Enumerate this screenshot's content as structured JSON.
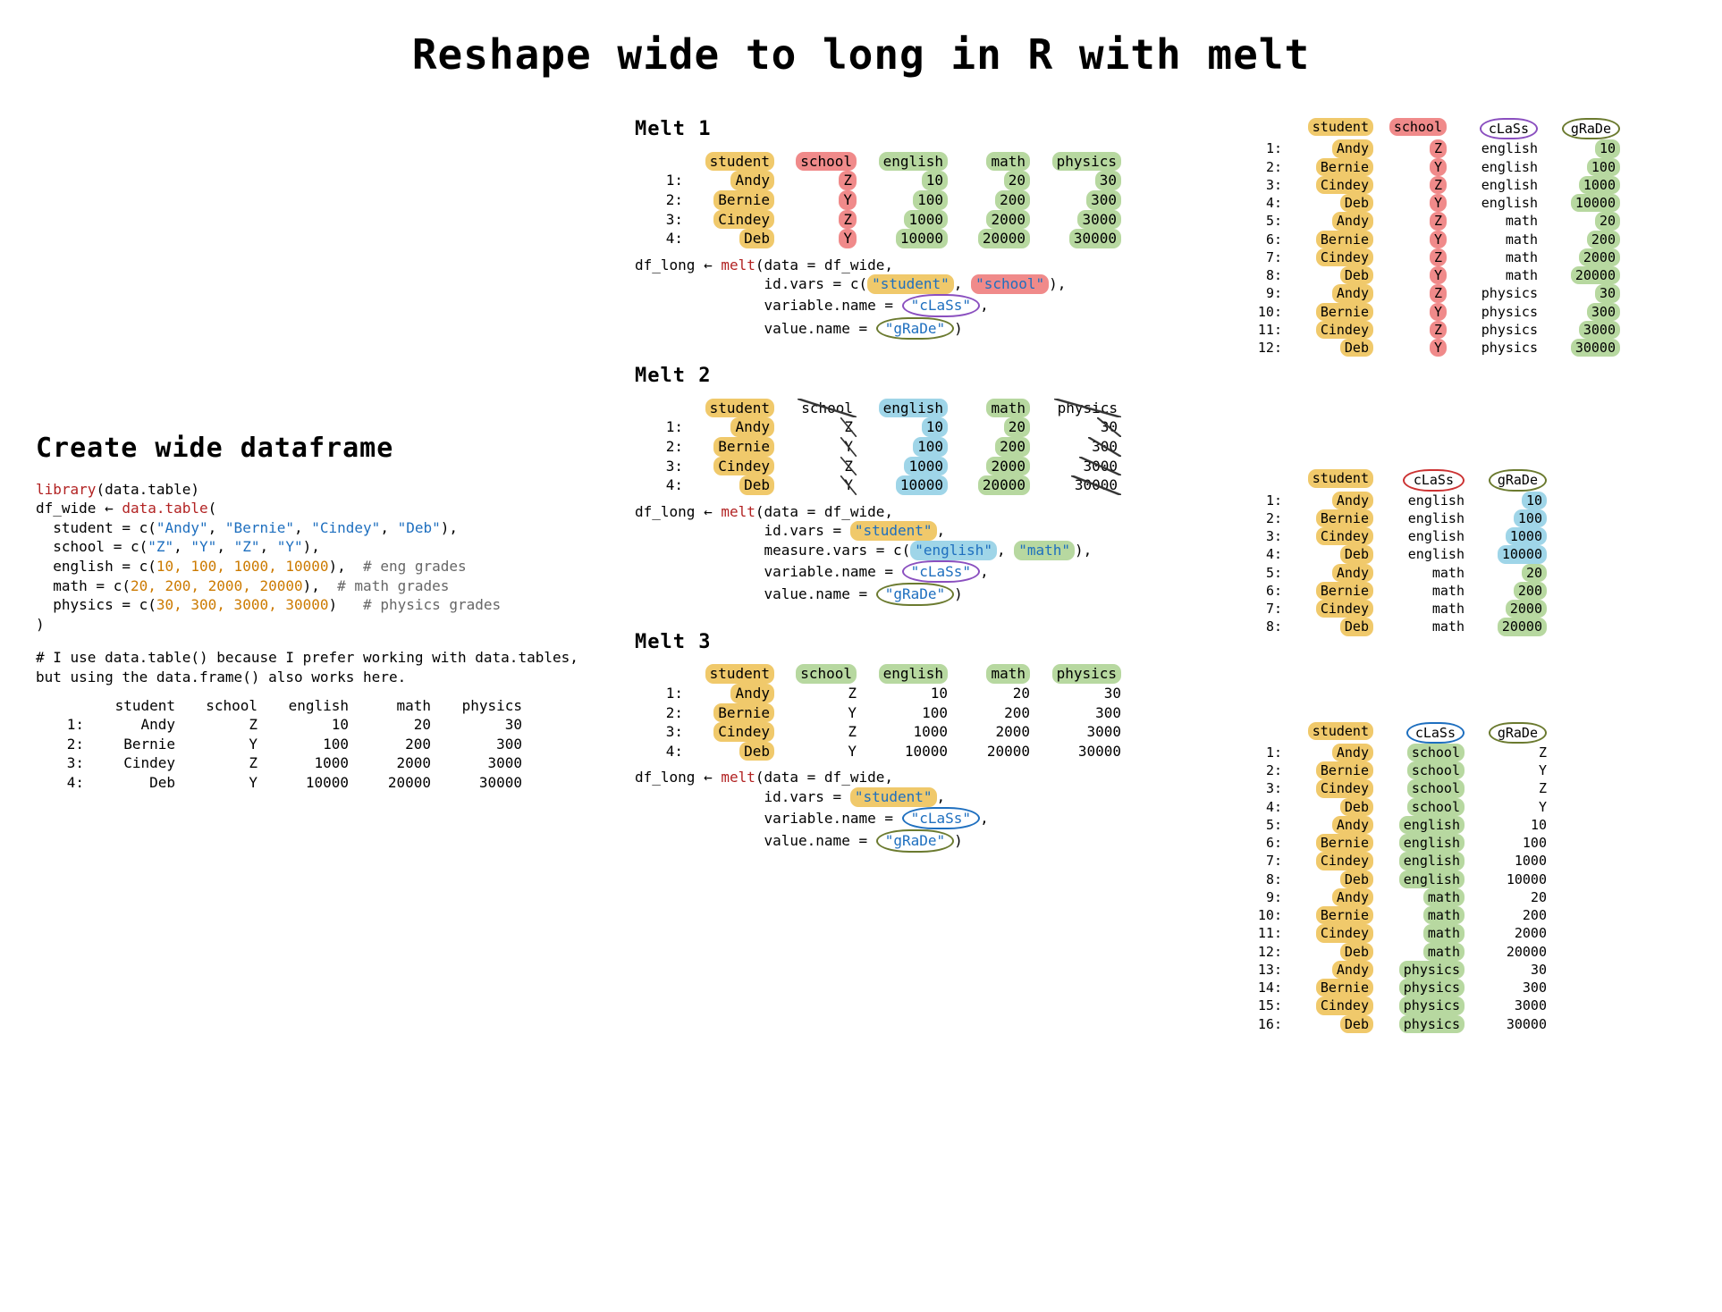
{
  "title": "Reshape wide to long in R with melt",
  "left": {
    "heading": "Create wide dataframe",
    "code": {
      "l1_a": "library",
      "l1_b": "(data.table)",
      "l2_a": "df_wide ← ",
      "l2_b": "data.table",
      "l2_c": "(",
      "l3_a": "  student = c(",
      "l3_s1": "\"Andy\"",
      "l3_c1": ", ",
      "l3_s2": "\"Bernie\"",
      "l3_c2": ", ",
      "l3_s3": "\"Cindey\"",
      "l3_c3": ", ",
      "l3_s4": "\"Deb\"",
      "l3_end": "),",
      "l4_a": "  school = c(",
      "l4_s1": "\"Z\"",
      "l4_c1": ", ",
      "l4_s2": "\"Y\"",
      "l4_c2": ", ",
      "l4_s3": "\"Z\"",
      "l4_c3": ", ",
      "l4_s4": "\"Y\"",
      "l4_end": "),",
      "l5_a": "  english = c(",
      "l5_n": "10, 100, 1000, 10000",
      "l5_end": "),  ",
      "l5_cmt": "# eng grades",
      "l6_a": "  math = c(",
      "l6_n": "20, 200, 2000, 20000",
      "l6_end": "),  ",
      "l6_cmt": "# math grades",
      "l7_a": "  physics = c(",
      "l7_n": "30, 300, 3000, 30000",
      "l7_end": ")   ",
      "l7_cmt": "# physics grades",
      "l8": ")"
    },
    "note_pre": "# I use ",
    "note_dt": "data.table()",
    "note_mid": " because I prefer working with data.tables, but using the ",
    "note_df": "data.frame()",
    "note_post": " also works here.",
    "wide_headers": [
      "student",
      "school",
      "english",
      "math",
      "physics"
    ],
    "wide_rows": [
      {
        "i": "1:",
        "cells": [
          "Andy",
          "Z",
          "10",
          "20",
          "30"
        ]
      },
      {
        "i": "2:",
        "cells": [
          "Bernie",
          "Y",
          "100",
          "200",
          "300"
        ]
      },
      {
        "i": "3:",
        "cells": [
          "Cindey",
          "Z",
          "1000",
          "2000",
          "3000"
        ]
      },
      {
        "i": "4:",
        "cells": [
          "Deb",
          "Y",
          "10000",
          "20000",
          "30000"
        ]
      }
    ]
  },
  "mid": {
    "melt1": {
      "title": "Melt 1",
      "headers": [
        "student",
        "school",
        "english",
        "math",
        "physics"
      ],
      "header_style": [
        "hl-y",
        "hl-r",
        "hl-g",
        "hl-g",
        "hl-g"
      ],
      "rows": [
        {
          "i": "1:",
          "cells": [
            "Andy",
            "Z",
            "10",
            "20",
            "30"
          ],
          "style": [
            "hl-y",
            "hl-r",
            "hl-g",
            "hl-g",
            "hl-g"
          ]
        },
        {
          "i": "2:",
          "cells": [
            "Bernie",
            "Y",
            "100",
            "200",
            "300"
          ],
          "style": [
            "hl-y",
            "hl-r",
            "hl-g",
            "hl-g",
            "hl-g"
          ]
        },
        {
          "i": "3:",
          "cells": [
            "Cindey",
            "Z",
            "1000",
            "2000",
            "3000"
          ],
          "style": [
            "hl-y",
            "hl-r",
            "hl-g",
            "hl-g",
            "hl-g"
          ]
        },
        {
          "i": "4:",
          "cells": [
            "Deb",
            "Y",
            "10000",
            "20000",
            "30000"
          ],
          "style": [
            "hl-y",
            "hl-r",
            "hl-g",
            "hl-g",
            "hl-g"
          ]
        }
      ],
      "code": {
        "l1_a": "df_long ← ",
        "l1_b": "melt",
        "l1_c": "(data = df_wide,",
        "l2_a": "               id.vars = c(",
        "l2_s1": "\"student\"",
        "l2_c": ", ",
        "l2_s2": "\"school\"",
        "l2_end": "),",
        "l3_a": "               variable.name = ",
        "l3_s": "\"cLaSs\"",
        "l3_end": ",",
        "l4_a": "               value.name = ",
        "l4_s": "\"gRaDe\"",
        "l4_end": ")"
      }
    },
    "melt2": {
      "title": "Melt 2",
      "headers": [
        "student",
        "school",
        "english",
        "math",
        "physics"
      ],
      "header_style": [
        "hl-y",
        "strike",
        "hl-b",
        "hl-g",
        "strike"
      ],
      "rows": [
        {
          "i": "1:",
          "cells": [
            "Andy",
            "Z",
            "10",
            "20",
            "30"
          ],
          "style": [
            "hl-y",
            "strike",
            "hl-b",
            "hl-g",
            "strike"
          ]
        },
        {
          "i": "2:",
          "cells": [
            "Bernie",
            "Y",
            "100",
            "200",
            "300"
          ],
          "style": [
            "hl-y",
            "strike",
            "hl-b",
            "hl-g",
            "strike"
          ]
        },
        {
          "i": "3:",
          "cells": [
            "Cindey",
            "Z",
            "1000",
            "2000",
            "3000"
          ],
          "style": [
            "hl-y",
            "strike",
            "hl-b",
            "hl-g",
            "strike"
          ]
        },
        {
          "i": "4:",
          "cells": [
            "Deb",
            "Y",
            "10000",
            "20000",
            "30000"
          ],
          "style": [
            "hl-y",
            "strike",
            "hl-b",
            "hl-g",
            "strike"
          ]
        }
      ],
      "code": {
        "l1_a": "df_long ← ",
        "l1_b": "melt",
        "l1_c": "(data = df_wide,",
        "l2_a": "               id.vars = ",
        "l2_s": "\"student\"",
        "l2_end": ",",
        "l3_a": "               measure.vars = c(",
        "l3_s1": "\"english\"",
        "l3_c": ", ",
        "l3_s2": "\"math\"",
        "l3_end": "),",
        "l4_a": "               variable.name = ",
        "l4_s": "\"cLaSs\"",
        "l4_end": ",",
        "l5_a": "               value.name = ",
        "l5_s": "\"gRaDe\"",
        "l5_end": ")"
      }
    },
    "melt3": {
      "title": "Melt 3",
      "headers": [
        "student",
        "school",
        "english",
        "math",
        "physics"
      ],
      "header_style": [
        "hl-y",
        "hl-g",
        "hl-g",
        "hl-g",
        "hl-g"
      ],
      "rows": [
        {
          "i": "1:",
          "cells": [
            "Andy",
            "Z",
            "10",
            "20",
            "30"
          ],
          "style": [
            "hl-y",
            "",
            "",
            "",
            ""
          ]
        },
        {
          "i": "2:",
          "cells": [
            "Bernie",
            "Y",
            "100",
            "200",
            "300"
          ],
          "style": [
            "hl-y",
            "",
            "",
            "",
            ""
          ]
        },
        {
          "i": "3:",
          "cells": [
            "Cindey",
            "Z",
            "1000",
            "2000",
            "3000"
          ],
          "style": [
            "hl-y",
            "",
            "",
            "",
            ""
          ]
        },
        {
          "i": "4:",
          "cells": [
            "Deb",
            "Y",
            "10000",
            "20000",
            "30000"
          ],
          "style": [
            "hl-y",
            "",
            "",
            "",
            ""
          ]
        }
      ],
      "code": {
        "l1_a": "df_long ← ",
        "l1_b": "melt",
        "l1_c": "(data = df_wide,",
        "l2_a": "               id.vars = ",
        "l2_s": "\"student\"",
        "l2_end": ",",
        "l3_a": "               variable.name = ",
        "l3_s": "\"cLaSs\"",
        "l3_end": ",",
        "l4_a": "               value.name = ",
        "l4_s": "\"gRaDe\"",
        "l4_end": ")"
      }
    }
  },
  "right": {
    "out1": {
      "headers": [
        "student",
        "school",
        "cLaSs",
        "gRaDe"
      ],
      "header_style": [
        "hl-y",
        "hl-r",
        "circ-purple",
        "circ-olive"
      ],
      "rows": [
        {
          "i": "1:",
          "cells": [
            "Andy",
            "Z",
            "english",
            "10"
          ],
          "style": [
            "hl-y",
            "hl-r",
            "",
            "hl-g"
          ]
        },
        {
          "i": "2:",
          "cells": [
            "Bernie",
            "Y",
            "english",
            "100"
          ],
          "style": [
            "hl-y",
            "hl-r",
            "",
            "hl-g"
          ]
        },
        {
          "i": "3:",
          "cells": [
            "Cindey",
            "Z",
            "english",
            "1000"
          ],
          "style": [
            "hl-y",
            "hl-r",
            "",
            "hl-g"
          ]
        },
        {
          "i": "4:",
          "cells": [
            "Deb",
            "Y",
            "english",
            "10000"
          ],
          "style": [
            "hl-y",
            "hl-r",
            "",
            "hl-g"
          ]
        },
        {
          "i": "5:",
          "cells": [
            "Andy",
            "Z",
            "math",
            "20"
          ],
          "style": [
            "hl-y",
            "hl-r",
            "",
            "hl-g"
          ]
        },
        {
          "i": "6:",
          "cells": [
            "Bernie",
            "Y",
            "math",
            "200"
          ],
          "style": [
            "hl-y",
            "hl-r",
            "",
            "hl-g"
          ]
        },
        {
          "i": "7:",
          "cells": [
            "Cindey",
            "Z",
            "math",
            "2000"
          ],
          "style": [
            "hl-y",
            "hl-r",
            "",
            "hl-g"
          ]
        },
        {
          "i": "8:",
          "cells": [
            "Deb",
            "Y",
            "math",
            "20000"
          ],
          "style": [
            "hl-y",
            "hl-r",
            "",
            "hl-g"
          ]
        },
        {
          "i": "9:",
          "cells": [
            "Andy",
            "Z",
            "physics",
            "30"
          ],
          "style": [
            "hl-y",
            "hl-r",
            "",
            "hl-g"
          ]
        },
        {
          "i": "10:",
          "cells": [
            "Bernie",
            "Y",
            "physics",
            "300"
          ],
          "style": [
            "hl-y",
            "hl-r",
            "",
            "hl-g"
          ]
        },
        {
          "i": "11:",
          "cells": [
            "Cindey",
            "Z",
            "physics",
            "3000"
          ],
          "style": [
            "hl-y",
            "hl-r",
            "",
            "hl-g"
          ]
        },
        {
          "i": "12:",
          "cells": [
            "Deb",
            "Y",
            "physics",
            "30000"
          ],
          "style": [
            "hl-y",
            "hl-r",
            "",
            "hl-g"
          ]
        }
      ]
    },
    "out2": {
      "headers": [
        "student",
        "cLaSs",
        "gRaDe"
      ],
      "header_style": [
        "hl-y",
        "circ-red",
        "circ-olive"
      ],
      "rows": [
        {
          "i": "1:",
          "cells": [
            "Andy",
            "english",
            "10"
          ],
          "style": [
            "hl-y",
            "",
            "hl-b"
          ]
        },
        {
          "i": "2:",
          "cells": [
            "Bernie",
            "english",
            "100"
          ],
          "style": [
            "hl-y",
            "",
            "hl-b"
          ]
        },
        {
          "i": "3:",
          "cells": [
            "Cindey",
            "english",
            "1000"
          ],
          "style": [
            "hl-y",
            "",
            "hl-b"
          ]
        },
        {
          "i": "4:",
          "cells": [
            "Deb",
            "english",
            "10000"
          ],
          "style": [
            "hl-y",
            "",
            "hl-b"
          ]
        },
        {
          "i": "5:",
          "cells": [
            "Andy",
            "math",
            "20"
          ],
          "style": [
            "hl-y",
            "",
            "hl-g"
          ]
        },
        {
          "i": "6:",
          "cells": [
            "Bernie",
            "math",
            "200"
          ],
          "style": [
            "hl-y",
            "",
            "hl-g"
          ]
        },
        {
          "i": "7:",
          "cells": [
            "Cindey",
            "math",
            "2000"
          ],
          "style": [
            "hl-y",
            "",
            "hl-g"
          ]
        },
        {
          "i": "8:",
          "cells": [
            "Deb",
            "math",
            "20000"
          ],
          "style": [
            "hl-y",
            "",
            "hl-g"
          ]
        }
      ]
    },
    "out3": {
      "headers": [
        "student",
        "cLaSs",
        "gRaDe"
      ],
      "header_style": [
        "hl-y",
        "circ-blue",
        "circ-olive"
      ],
      "rows": [
        {
          "i": "1:",
          "cells": [
            "Andy",
            "school",
            "Z"
          ],
          "style": [
            "hl-y",
            "hl-g",
            ""
          ]
        },
        {
          "i": "2:",
          "cells": [
            "Bernie",
            "school",
            "Y"
          ],
          "style": [
            "hl-y",
            "hl-g",
            ""
          ]
        },
        {
          "i": "3:",
          "cells": [
            "Cindey",
            "school",
            "Z"
          ],
          "style": [
            "hl-y",
            "hl-g",
            ""
          ]
        },
        {
          "i": "4:",
          "cells": [
            "Deb",
            "school",
            "Y"
          ],
          "style": [
            "hl-y",
            "hl-g",
            ""
          ]
        },
        {
          "i": "5:",
          "cells": [
            "Andy",
            "english",
            "10"
          ],
          "style": [
            "hl-y",
            "hl-g",
            ""
          ]
        },
        {
          "i": "6:",
          "cells": [
            "Bernie",
            "english",
            "100"
          ],
          "style": [
            "hl-y",
            "hl-g",
            ""
          ]
        },
        {
          "i": "7:",
          "cells": [
            "Cindey",
            "english",
            "1000"
          ],
          "style": [
            "hl-y",
            "hl-g",
            ""
          ]
        },
        {
          "i": "8:",
          "cells": [
            "Deb",
            "english",
            "10000"
          ],
          "style": [
            "hl-y",
            "hl-g",
            ""
          ]
        },
        {
          "i": "9:",
          "cells": [
            "Andy",
            "math",
            "20"
          ],
          "style": [
            "hl-y",
            "hl-g",
            ""
          ]
        },
        {
          "i": "10:",
          "cells": [
            "Bernie",
            "math",
            "200"
          ],
          "style": [
            "hl-y",
            "hl-g",
            ""
          ]
        },
        {
          "i": "11:",
          "cells": [
            "Cindey",
            "math",
            "2000"
          ],
          "style": [
            "hl-y",
            "hl-g",
            ""
          ]
        },
        {
          "i": "12:",
          "cells": [
            "Deb",
            "math",
            "20000"
          ],
          "style": [
            "hl-y",
            "hl-g",
            ""
          ]
        },
        {
          "i": "13:",
          "cells": [
            "Andy",
            "physics",
            "30"
          ],
          "style": [
            "hl-y",
            "hl-g",
            ""
          ]
        },
        {
          "i": "14:",
          "cells": [
            "Bernie",
            "physics",
            "300"
          ],
          "style": [
            "hl-y",
            "hl-g",
            ""
          ]
        },
        {
          "i": "15:",
          "cells": [
            "Cindey",
            "physics",
            "3000"
          ],
          "style": [
            "hl-y",
            "hl-g",
            ""
          ]
        },
        {
          "i": "16:",
          "cells": [
            "Deb",
            "physics",
            "30000"
          ],
          "style": [
            "hl-y",
            "hl-g",
            ""
          ]
        }
      ]
    }
  },
  "colwidths": {
    "wide": [
      "w90",
      "w80",
      "w90",
      "w80",
      "w90"
    ],
    "out1": [
      "w90",
      "w70",
      "w90",
      "w80"
    ],
    "out2": [
      "w90",
      "w90",
      "w80"
    ],
    "out3": [
      "w90",
      "w90",
      "w80"
    ]
  }
}
